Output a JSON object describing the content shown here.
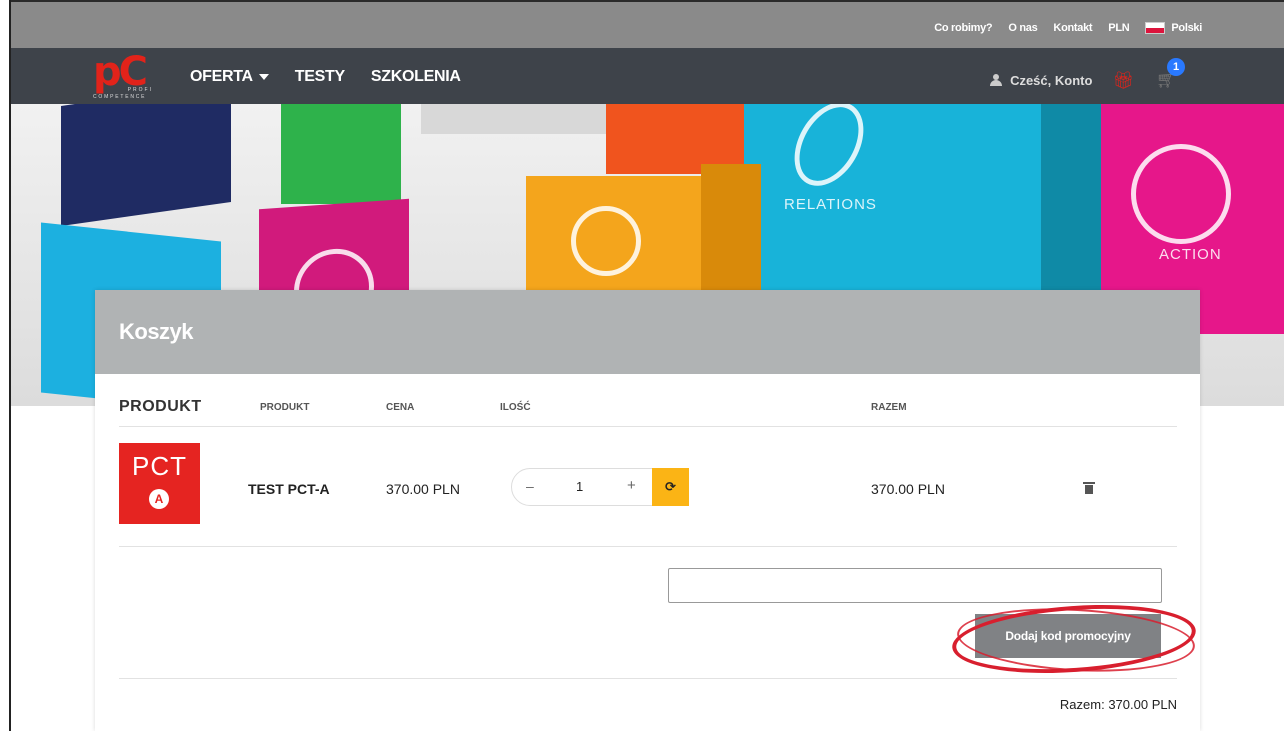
{
  "topbar": {
    "links": [
      "Co robimy?",
      "O nas",
      "Kontakt",
      "PLN"
    ],
    "language": "Polski"
  },
  "navbar": {
    "logo": {
      "main": "pC",
      "line1": "PROFI",
      "line2": "COMPETENCE"
    },
    "items": [
      "OFERTA",
      "TESTY",
      "SZKOLENIA"
    ],
    "account_label": "Cześć, Konto",
    "cart_count": "1"
  },
  "hero": {
    "labels": {
      "relations": "RELATIONS",
      "action": "ACTION"
    }
  },
  "cart": {
    "title": "Koszyk",
    "headers": {
      "product_big": "PRODUKT",
      "product": "PRODUKT",
      "price": "CENA",
      "qty": "ILOŚĆ",
      "total": "RAZEM"
    },
    "items": [
      {
        "thumb_text": "PCT",
        "thumb_badge": "A",
        "name": "TEST PCT-A",
        "price": "370.00 PLN",
        "qty": "1",
        "total": "370.00 PLN"
      }
    ],
    "qty_controls": {
      "minus": "–",
      "plus": "+",
      "refresh": "⟳"
    },
    "promo": {
      "input_value": "",
      "placeholder": "",
      "button": "Dodaj kod promocyjny"
    },
    "grand_total": "Razem: 370.00 PLN"
  },
  "colors": {
    "topbar": "#8a8a8a",
    "navbar": "#3e434a",
    "brand_red": "#e2231a",
    "refresh_yellow": "#fbb415",
    "badge_blue": "#2979ff",
    "highlight_red": "#d81f2e"
  }
}
